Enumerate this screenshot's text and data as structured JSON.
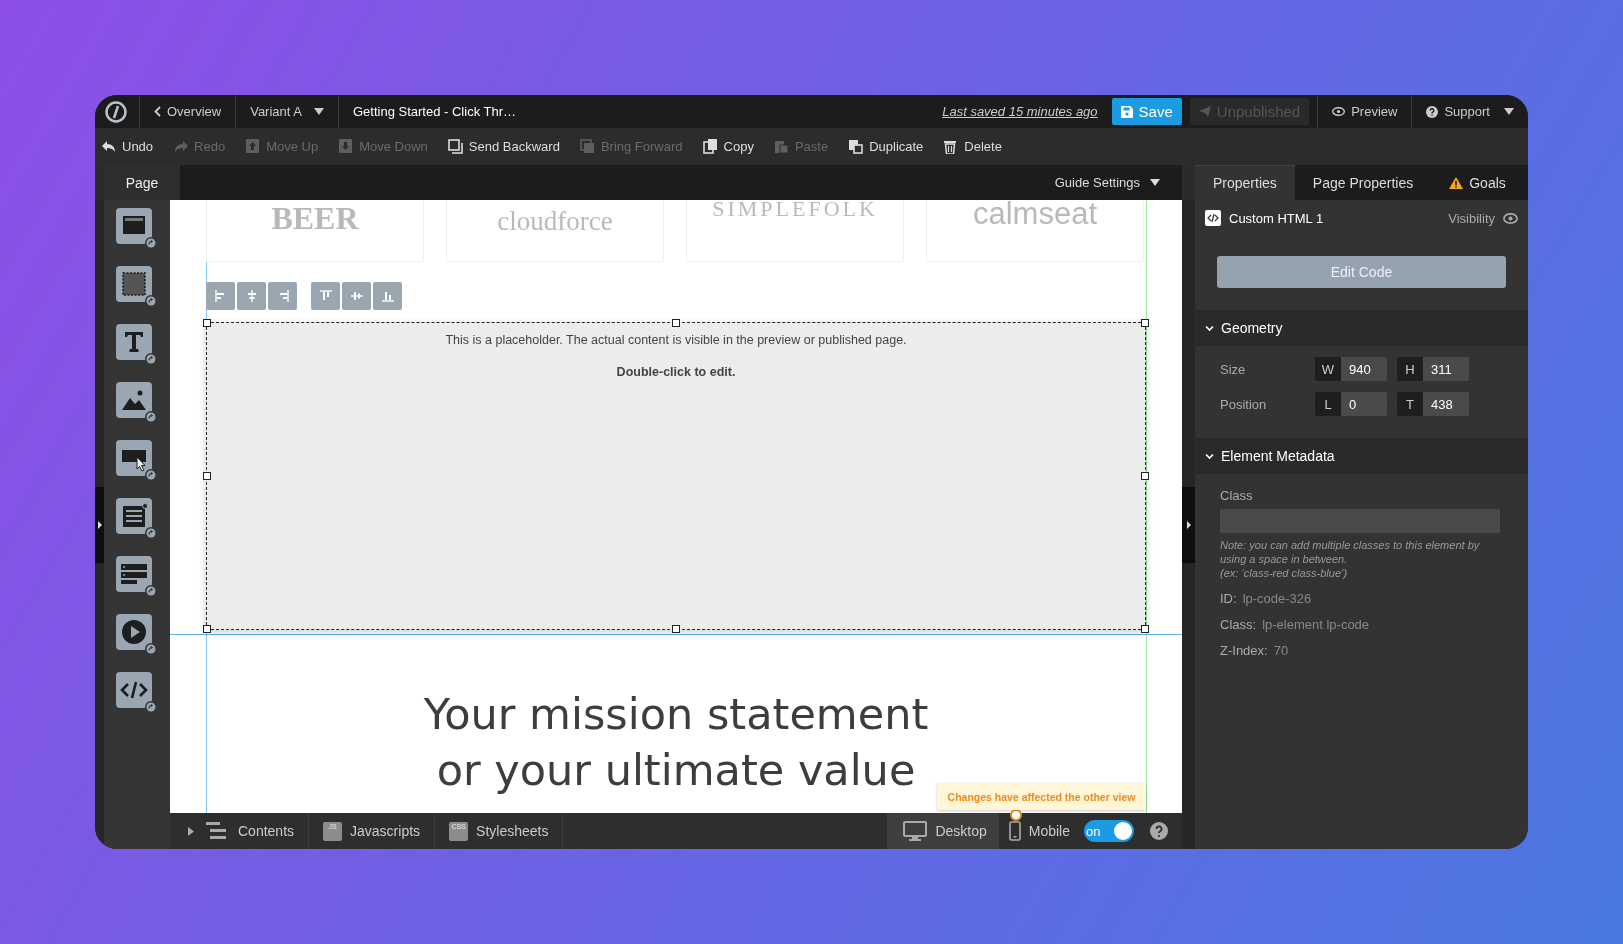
{
  "top_bar": {
    "back_link": "Overview",
    "variant": "Variant A",
    "page_title": "Getting Started - Click Thr…",
    "last_saved": "Last saved  15 minutes ago",
    "save": "Save",
    "publish": {
      "label": "Unpublished",
      "disabled": true
    },
    "preview": "Preview",
    "support": "Support"
  },
  "toolbar": [
    {
      "label": "Undo",
      "disabled": false
    },
    {
      "label": "Redo",
      "disabled": true
    },
    {
      "label": "Move Up",
      "disabled": true
    },
    {
      "label": "Move Down",
      "disabled": true
    },
    {
      "label": "Send Backward",
      "disabled": false
    },
    {
      "label": "Bring Forward",
      "disabled": true
    },
    {
      "label": "Copy",
      "disabled": false
    },
    {
      "label": "Paste",
      "disabled": true
    },
    {
      "label": "Duplicate",
      "disabled": false
    },
    {
      "label": "Delete",
      "disabled": false
    }
  ],
  "canvas_header": {
    "tab": "Page",
    "guide_settings": "Guide Settings"
  },
  "canvas": {
    "logos": [
      "BEER",
      "cloudforce",
      "SIMPLEFOLK",
      "calmseat"
    ],
    "placeholder": {
      "message": "This is a placeholder. The actual content is visible in the preview or published page.",
      "hint": "Double-click to edit."
    },
    "heading": [
      "Your mission statement",
      "or your ultimate value"
    ]
  },
  "tooltip": "Changes have affected the other view",
  "bottom_bar": {
    "panels": [
      {
        "label": "Contents"
      },
      {
        "label": "Javascripts",
        "badge": "JS"
      },
      {
        "label": "Stylesheets",
        "badge": "CSS"
      }
    ],
    "views": [
      {
        "label": "Desktop",
        "selected": true,
        "notice": false
      },
      {
        "label": "Mobile",
        "selected": false,
        "notice": true
      }
    ],
    "mobile_toggle": {
      "label": "on",
      "on": true
    }
  },
  "panel": {
    "tabs": [
      {
        "label": "Properties",
        "selected": true,
        "warning": false
      },
      {
        "label": "Page Properties",
        "selected": false,
        "warning": false
      },
      {
        "label": "Goals",
        "selected": false,
        "warning": true
      }
    ],
    "element": {
      "name": "Custom HTML 1",
      "visibility": "Visibility"
    },
    "edit_button": "Edit Code",
    "geometry": {
      "title": "Geometry",
      "expanded": true,
      "rows": [
        {
          "label": "Size",
          "fields": [
            {
              "prefix": "W",
              "value": "940"
            },
            {
              "prefix": "H",
              "value": "311"
            }
          ]
        },
        {
          "label": "Position",
          "fields": [
            {
              "prefix": "L",
              "value": "0"
            },
            {
              "prefix": "T",
              "value": "438"
            }
          ]
        }
      ]
    },
    "metadata": {
      "title": "Element Metadata",
      "expanded": true,
      "class_label": "Class",
      "note": "Note: you can add multiple classes to this element by using a space in between.\n(ex: ‘class-red class-blue’)",
      "facts": [
        {
          "label": "ID:",
          "value": "lp-code-326"
        },
        {
          "label": "Class:",
          "value": "lp-element lp-code"
        },
        {
          "label": "Z-Index:",
          "value": "70"
        }
      ]
    }
  }
}
